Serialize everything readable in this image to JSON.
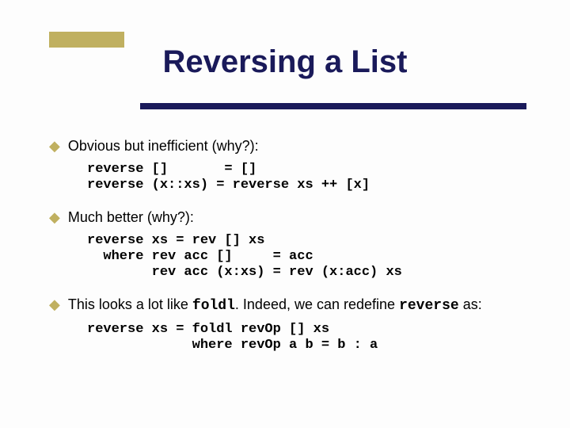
{
  "title": "Reversing a List",
  "bullets": [
    {
      "text": "Obvious but inefficient (why?):"
    },
    {
      "text": "Much better (why?):"
    },
    {
      "text_pre": "This looks a lot like ",
      "code": "foldl",
      "text_mid": ".  Indeed, we can redefine ",
      "code2": "reverse",
      "text_post": " as:"
    }
  ],
  "code_blocks": {
    "one": "reverse []       = []\nreverse (x::xs) = reverse xs ++ [x]",
    "two": "reverse xs = rev [] xs\n  where rev acc []     = acc\n        rev acc (x:xs) = rev (x:acc) xs",
    "three": "reverse xs = foldl revOp [] xs\n             where revOp a b = b : a"
  }
}
